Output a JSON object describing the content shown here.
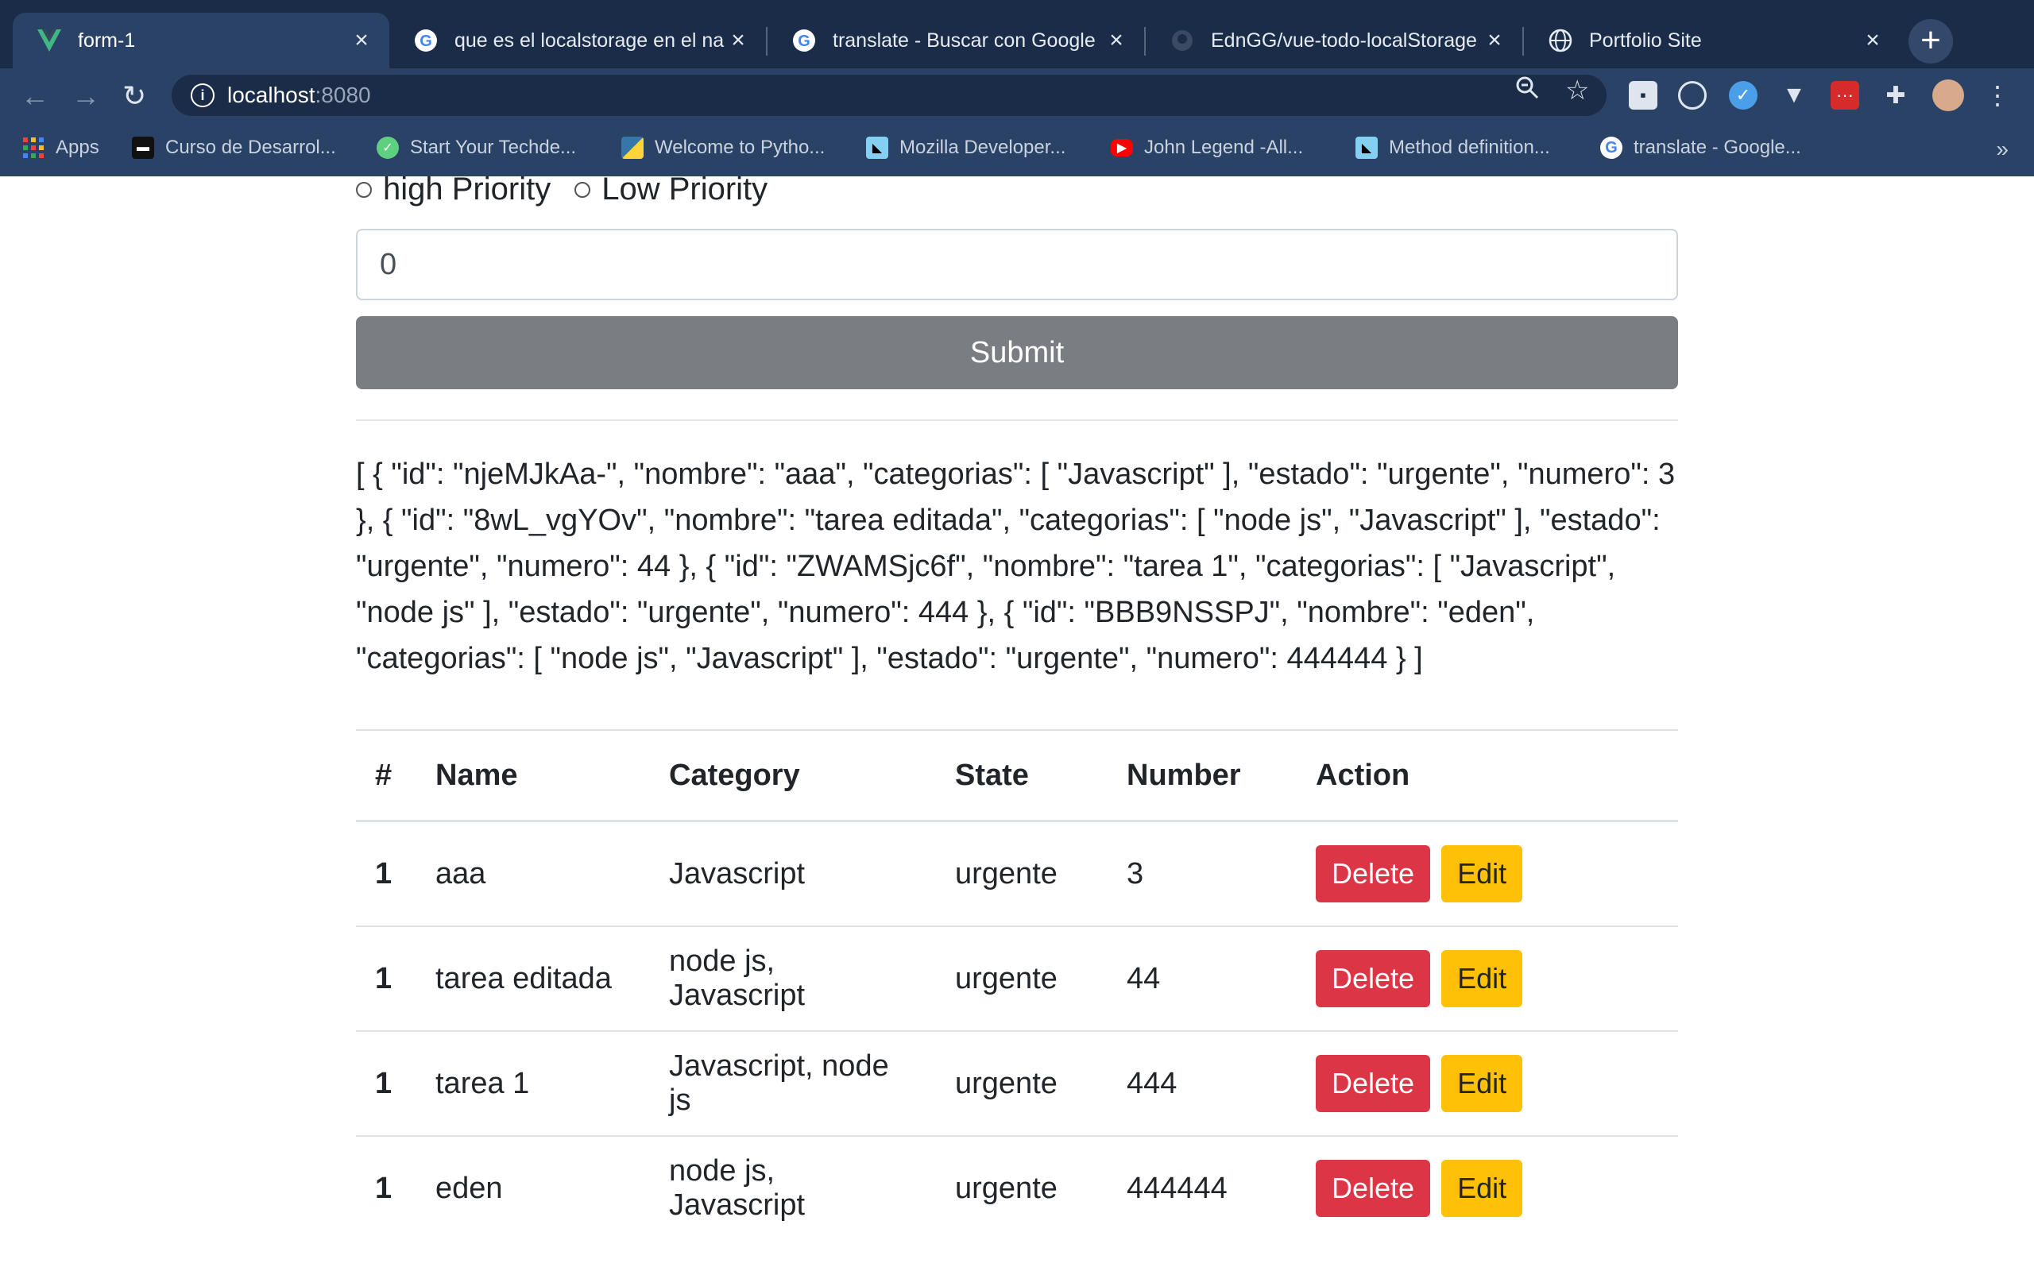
{
  "browser": {
    "tabs": [
      {
        "title": "form-1",
        "icon": "vue-icon",
        "active": true
      },
      {
        "title": "que es el localstorage en el na",
        "icon": "google-icon",
        "active": false
      },
      {
        "title": "translate - Buscar con Google",
        "icon": "google-icon",
        "active": false
      },
      {
        "title": "EdnGG/vue-todo-localStorage",
        "icon": "github-icon",
        "active": false
      },
      {
        "title": "Portfolio Site",
        "icon": "globe-icon",
        "active": false
      }
    ],
    "url_host": "localhost",
    "url_port": ":8080",
    "bookmarks": [
      {
        "label": "Apps",
        "icon": "apps-grid-icon"
      },
      {
        "label": "Curso de Desarrol...",
        "icon": "folder-icon"
      },
      {
        "label": "Start Your Techde...",
        "icon": "techdegree-icon"
      },
      {
        "label": "Welcome to Pytho...",
        "icon": "python-icon"
      },
      {
        "label": "Mozilla Developer...",
        "icon": "mdn-icon"
      },
      {
        "label": "John Legend -All...",
        "icon": "youtube-icon"
      },
      {
        "label": "Method definition...",
        "icon": "mdn-icon"
      },
      {
        "label": "translate - Google...",
        "icon": "google-icon"
      }
    ],
    "bookmarks_more": "»"
  },
  "form": {
    "radios": [
      "high Priority",
      "Low Priority"
    ],
    "number_value": "0",
    "submit_label": "Submit"
  },
  "json_dump": "[ { \"id\": \"njeMJkAa-\", \"nombre\": \"aaa\", \"categorias\": [ \"Javascript\" ], \"estado\": \"urgente\", \"numero\": 3 }, { \"id\": \"8wL_vgYOv\", \"nombre\": \"tarea editada\", \"categorias\": [ \"node js\", \"Javascript\" ], \"estado\": \"urgente\", \"numero\": 44 }, { \"id\": \"ZWAMSjc6f\", \"nombre\": \"tarea 1\", \"categorias\": [ \"Javascript\", \"node js\" ], \"estado\": \"urgente\", \"numero\": 444 }, { \"id\": \"BBB9NSSPJ\", \"nombre\": \"eden\", \"categorias\": [ \"node js\", \"Javascript\" ], \"estado\": \"urgente\", \"numero\": 444444 } ]",
  "table": {
    "headers": [
      "#",
      "Name",
      "Category",
      "State",
      "Number",
      "Action"
    ],
    "rows": [
      {
        "idx": "1",
        "name": "aaa",
        "category": "Javascript",
        "state": "urgente",
        "number": "3"
      },
      {
        "idx": "1",
        "name": "tarea editada",
        "category": "node js, Javascript",
        "state": "urgente",
        "number": "44"
      },
      {
        "idx": "1",
        "name": "tarea 1",
        "category": "Javascript, node js",
        "state": "urgente",
        "number": "444"
      },
      {
        "idx": "1",
        "name": "eden",
        "category": "node js, Javascript",
        "state": "urgente",
        "number": "444444"
      }
    ],
    "delete_label": "Delete",
    "edit_label": "Edit"
  },
  "colors": {
    "danger": "#dc3545",
    "warning": "#ffc107",
    "secondary": "#7a7e83",
    "chrome_dark": "#1b2c48",
    "chrome_mid": "#2a4266"
  }
}
